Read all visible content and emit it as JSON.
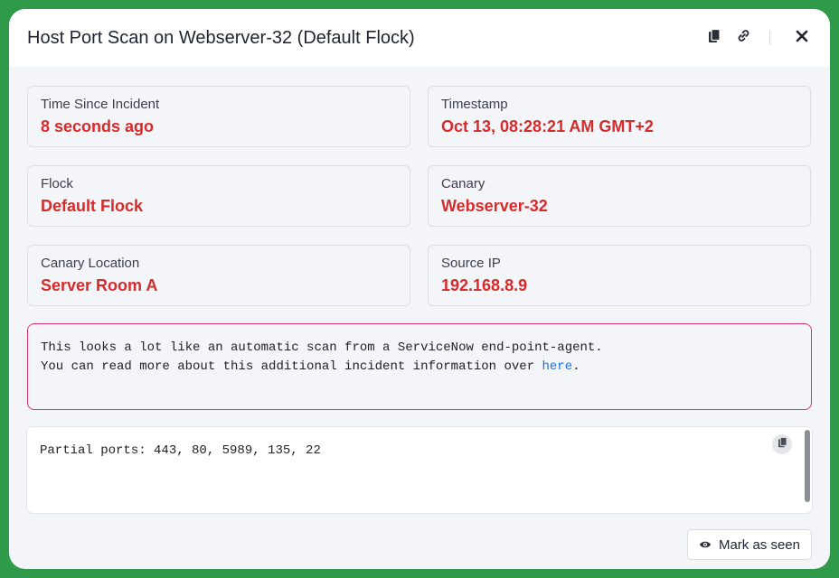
{
  "header": {
    "title": "Host Port Scan on Webserver-32 (Default Flock)",
    "icons": [
      "clipboard-icon",
      "link-icon",
      "close-icon"
    ]
  },
  "cards": [
    {
      "label": "Time Since Incident",
      "value": "8 seconds ago"
    },
    {
      "label": "Timestamp",
      "value": "Oct 13, 08:28:21 AM GMT+2"
    },
    {
      "label": "Flock",
      "value": "Default Flock"
    },
    {
      "label": "Canary",
      "value": "Webserver-32"
    },
    {
      "label": "Canary Location",
      "value": "Server Room A"
    },
    {
      "label": "Source IP",
      "value": "192.168.8.9"
    }
  ],
  "note": {
    "line1": "This looks a lot like an automatic scan from a ServiceNow end-point-agent.",
    "line2_prefix": "You can read more about this additional incident information over ",
    "link_text": "here",
    "line2_suffix": "."
  },
  "details": {
    "text": "Partial ports: 443, 80, 5989, 135, 22"
  },
  "footer": {
    "mark_seen_label": "Mark as seen"
  },
  "colors": {
    "accent_red": "#d62b2b",
    "note_border": "#d8366b",
    "link": "#1f6fd1",
    "frame_green": "#2e9a4a"
  }
}
